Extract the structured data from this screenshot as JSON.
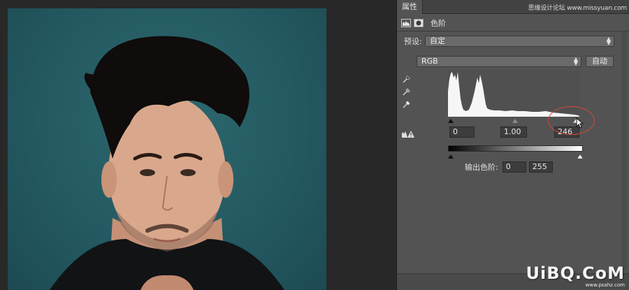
{
  "panel": {
    "tab_label": "属性",
    "watermark_site": "思缘设计论坛 www.missyuan.com",
    "header_icons": [
      "levels-adjustment-icon",
      "layer-mask-icon"
    ],
    "title": "色阶",
    "preset_label": "预设:",
    "preset_value": "自定",
    "channel_value": "RGB",
    "auto_button": "自动",
    "eyedroppers": [
      "black-point-eyedropper-icon",
      "gray-point-eyedropper-icon",
      "white-point-eyedropper-icon"
    ],
    "input_levels": {
      "black": "0",
      "gamma": "1.00",
      "white": "246"
    },
    "output_label": "输出色阶:",
    "output_levels": {
      "black": "0",
      "white": "255"
    }
  },
  "colors": {
    "panel_bg": "#535353",
    "canvas_bg": "#282828",
    "photo_backdrop": "#245a62",
    "highlight_circle": "#d34a35"
  },
  "watermark": {
    "logo": "UiBQ.CoM",
    "url": "www.psahz.com"
  }
}
